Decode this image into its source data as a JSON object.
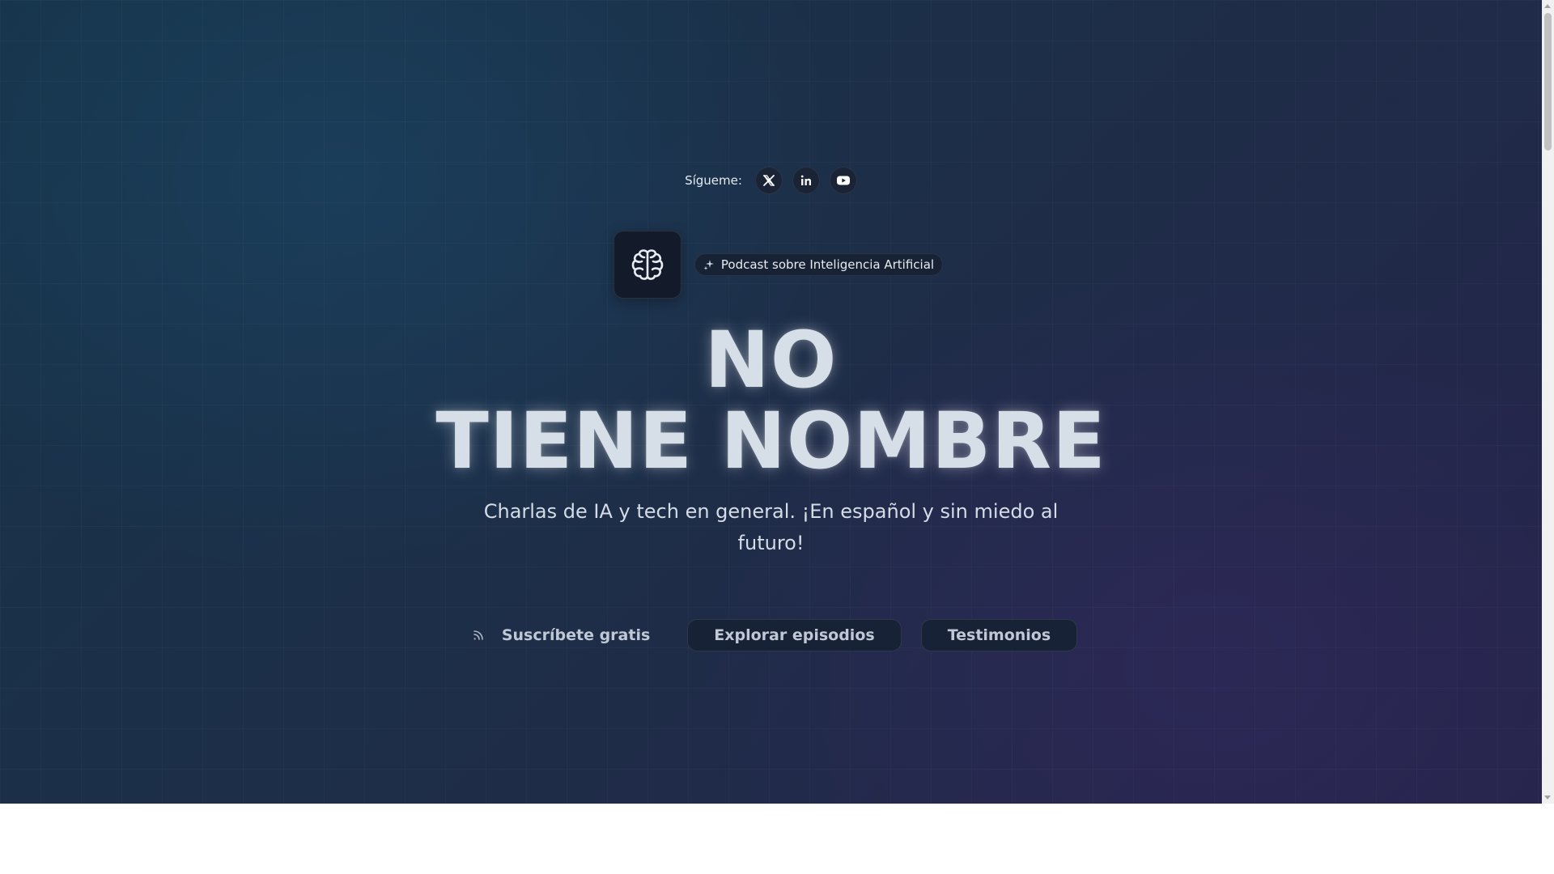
{
  "follow": {
    "label": "Sígueme:",
    "socials": [
      {
        "icon": "x-twitter-icon"
      },
      {
        "icon": "linkedin-icon"
      },
      {
        "icon": "youtube-icon"
      }
    ]
  },
  "brand": {
    "logo_icon": "brain-icon",
    "badge_icon": "sparkles-icon",
    "badge_text": "Podcast sobre Inteligencia Artificial"
  },
  "hero": {
    "title_line1": "NO",
    "title_line2": "TIENE NOMBRE",
    "subtitle": "Charlas de IA y tech en general. ¡En español y sin miedo al futuro!"
  },
  "actions": {
    "subscribe_icon": "rss-icon",
    "subscribe_label": "Suscríbete gratis",
    "explore_label": "Explorar episodios",
    "testimonials_label": "Testimonios"
  },
  "colors": {
    "background_start": "#16344a",
    "background_end": "#25244a",
    "title": "#d6dee7",
    "button_bg": "#182236"
  }
}
